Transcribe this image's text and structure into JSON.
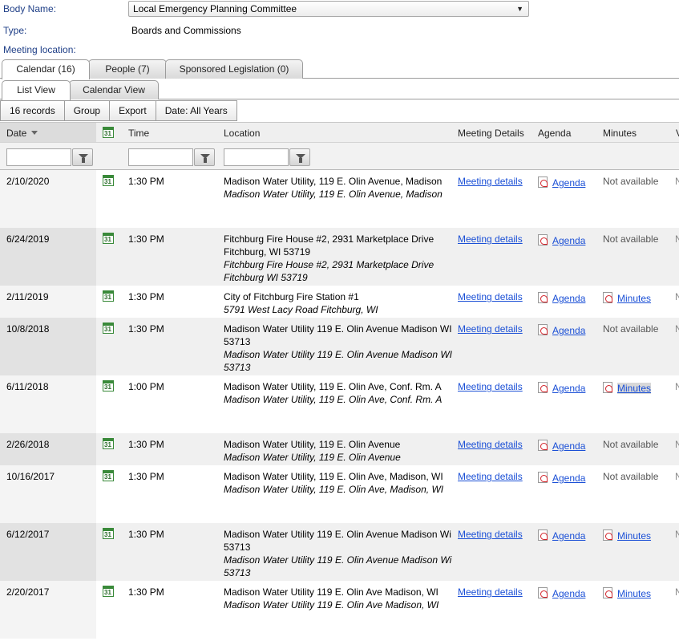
{
  "info": {
    "body_name_label": "Body Name:",
    "body_name_value": "Local Emergency Planning Committee",
    "type_label": "Type:",
    "type_value": "Boards and Commissions",
    "location_label": "Meeting location:"
  },
  "tabs": {
    "calendar": "Calendar (16)",
    "people": "People (7)",
    "legislation": "Sponsored Legislation (0)"
  },
  "subtabs": {
    "list": "List View",
    "calendar": "Calendar View"
  },
  "toolbar": {
    "records": "16 records",
    "group": "Group",
    "export": "Export",
    "date": "Date: All Years"
  },
  "headers": {
    "date": "Date",
    "time": "Time",
    "location": "Location",
    "details": "Meeting Details",
    "agenda": "Agenda",
    "minutes": "Minutes",
    "extra": "V"
  },
  "icons": {
    "calendar": "calendar-31-icon",
    "pdf": "pdf-icon",
    "filter": "funnel-icon",
    "dropdown": "chevron-down-icon"
  },
  "calendar_icon_text": "31",
  "rows": [
    {
      "date": "2/10/2020",
      "time": "1:30 PM",
      "loc1": "Madison Water Utility, 119 E. Olin Avenue, Madison",
      "loc2": "Madison Water Utility, 119 E. Olin Avenue, Madison",
      "details": "Meeting details",
      "agenda": "Agenda",
      "minutes": "Not available",
      "minutes_link": false,
      "extra": "N"
    },
    {
      "date": "6/24/2019",
      "time": "1:30 PM",
      "loc1": "Fitchburg Fire House #2, 2931 Marketplace Drive Fitchburg, WI 53719",
      "loc2": "Fitchburg Fire House #2, 2931 Marketplace Drive Fitchburg WI 53719",
      "details": "Meeting details",
      "agenda": "Agenda",
      "minutes": "Not available",
      "minutes_link": false,
      "extra": "N"
    },
    {
      "date": "2/11/2019",
      "time": "1:30 PM",
      "loc1": "City of Fitchburg Fire Station #1",
      "loc2": "5791 West Lacy Road Fitchburg, WI",
      "details": "Meeting details",
      "agenda": "Agenda",
      "minutes": "Minutes",
      "minutes_link": true,
      "extra": "N"
    },
    {
      "date": "10/8/2018",
      "time": "1:30 PM",
      "loc1": "Madison Water Utility 119 E. Olin Avenue Madison WI 53713",
      "loc2": "Madison Water Utility 119 E. Olin Avenue Madison WI 53713",
      "details": "Meeting details",
      "agenda": "Agenda",
      "minutes": "Not available",
      "minutes_link": false,
      "extra": "N"
    },
    {
      "date": "6/11/2018",
      "time": "1:00 PM",
      "loc1": "Madison Water Utility, 119 E. Olin Ave, Conf. Rm. A",
      "loc2": "Madison Water Utility, 119 E. Olin Ave, Conf. Rm. A",
      "details": "Meeting details",
      "agenda": "Agenda",
      "minutes": "Minutes",
      "minutes_link": true,
      "extra": "N"
    },
    {
      "date": "2/26/2018",
      "time": "1:30 PM",
      "loc1": "Madison Water Utility, 119 E. Olin Avenue",
      "loc2": "Madison Water Utility, 119 E. Olin Avenue",
      "details": "Meeting details",
      "agenda": "Agenda",
      "minutes": "Not available",
      "minutes_link": false,
      "extra": "N"
    },
    {
      "date": "10/16/2017",
      "time": "1:30 PM",
      "loc1": "Madison Water Utility, 119 E. Olin Ave, Madison, WI",
      "loc2": "Madison Water Utility, 119 E. Olin Ave, Madison, WI",
      "details": "Meeting details",
      "agenda": "Agenda",
      "minutes": "Not available",
      "minutes_link": false,
      "extra": "N"
    },
    {
      "date": "6/12/2017",
      "time": "1:30 PM",
      "loc1": "Madison Water Utility 119 E. Olin Avenue Madison Wi 53713",
      "loc2": "Madison Water Utility 119 E. Olin Avenue Madison Wi 53713",
      "details": "Meeting details",
      "agenda": "Agenda",
      "minutes": "Minutes",
      "minutes_link": true,
      "extra": "N"
    },
    {
      "date": "2/20/2017",
      "time": "1:30 PM",
      "loc1": "Madison Water Utility 119 E. Olin Ave Madison, WI",
      "loc2": "Madison Water Utility 119 E. Olin Ave Madison, WI",
      "details": "Meeting details",
      "agenda": "Agenda",
      "minutes": "Minutes",
      "minutes_link": true,
      "extra": "N"
    }
  ]
}
